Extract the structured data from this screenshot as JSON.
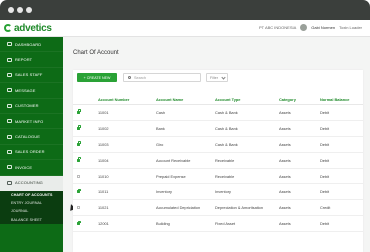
{
  "app": {
    "brand": "advetics",
    "header_left_info": "PT ABC INDONESIA",
    "user_name": "Gabi Normen",
    "user_company": "Toxin Loader"
  },
  "sidebar": {
    "items": [
      {
        "label": "DASHBOARD",
        "icon": "dashboard-icon"
      },
      {
        "label": "REPORT",
        "icon": "report-icon"
      },
      {
        "label": "SALES STAFF",
        "icon": "sales-staff-icon"
      },
      {
        "label": "MESSAGE",
        "icon": "message-icon"
      },
      {
        "label": "CUSTOMER",
        "icon": "customer-icon"
      },
      {
        "label": "MARKET INFO",
        "icon": "market-info-icon"
      },
      {
        "label": "CATALOGUE",
        "icon": "catalogue-icon"
      },
      {
        "label": "SALES ORDER",
        "icon": "sales-order-icon"
      },
      {
        "label": "INVOICE",
        "icon": "invoice-icon"
      }
    ],
    "group": {
      "label": "ACCOUNTING",
      "icon": "accounting-icon"
    },
    "sub_items": [
      {
        "label": "CHART OF ACCOUNTS",
        "selected": true
      },
      {
        "label": "ENTRY JOURNAL",
        "selected": false
      },
      {
        "label": "JOURNAL",
        "selected": false
      },
      {
        "label": "BALANCE SHEET",
        "selected": false
      }
    ]
  },
  "main": {
    "title": "Chart Of Account",
    "create_button": "+ CREATE NEW",
    "search_placeholder": "Search",
    "filter_label": "Filter",
    "columns": [
      "Account Number",
      "Account Name",
      "Account Type",
      "Category",
      "Normal Balance"
    ],
    "rows": [
      {
        "locked": true,
        "number": "11001",
        "name": "Cash",
        "type": "Cash & Bank",
        "category": "Assets",
        "balance": "Debit"
      },
      {
        "locked": true,
        "number": "11002",
        "name": "Bank",
        "type": "Cash & Bank",
        "category": "Assets",
        "balance": "Debit"
      },
      {
        "locked": true,
        "number": "11003",
        "name": "Giro",
        "type": "Cash & Bank",
        "category": "Assets",
        "balance": "Debit"
      },
      {
        "locked": true,
        "number": "11004",
        "name": "Account Receivable",
        "type": "Receivable",
        "category": "Assets",
        "balance": "Debit"
      },
      {
        "locked": false,
        "number": "11010",
        "name": "Prepaid Expense",
        "type": "Receivable",
        "category": "Assets",
        "balance": "Debit"
      },
      {
        "locked": true,
        "number": "11011",
        "name": "Inventory",
        "type": "Inventory",
        "category": "Assets",
        "balance": "Debit"
      },
      {
        "locked": false,
        "number": "11021",
        "name": "Accumulated Depriciation",
        "type": "Depreciation & Amortisation",
        "category": "Assets",
        "balance": "Credit"
      },
      {
        "locked": true,
        "number": "12001",
        "name": "Building",
        "type": "Fixed Asset",
        "category": "Assets",
        "balance": "Debit"
      }
    ]
  },
  "colors": {
    "sidebar_bg": "#0d6b16",
    "accent": "#2aa236",
    "submenu_bg": "#0b3d10"
  }
}
